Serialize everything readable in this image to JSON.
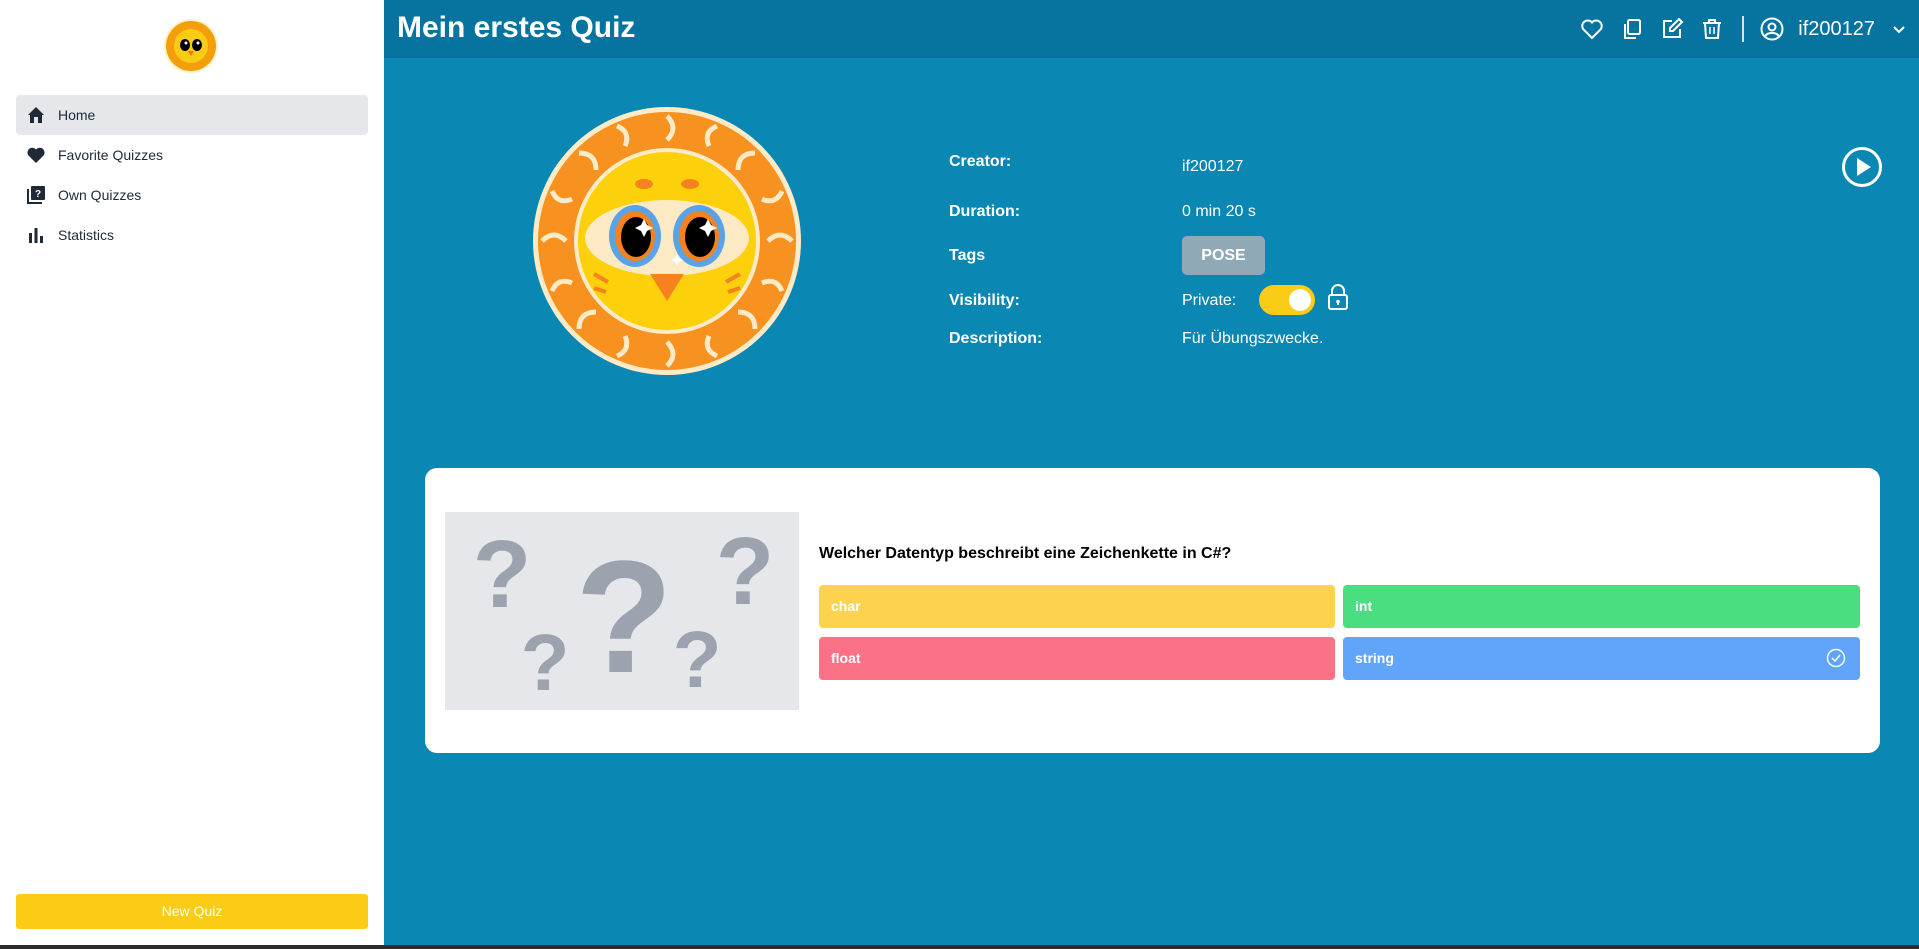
{
  "sidebar": {
    "items": [
      {
        "label": "Home",
        "icon": "home-icon",
        "active": true
      },
      {
        "label": "Favorite Quizzes",
        "icon": "heart-icon",
        "active": false
      },
      {
        "label": "Own Quizzes",
        "icon": "quiz-library-icon",
        "active": false
      },
      {
        "label": "Statistics",
        "icon": "bar-chart-icon",
        "active": false
      }
    ],
    "new_quiz_label": "New Quiz"
  },
  "header": {
    "title": "Mein erstes Quiz",
    "actions": [
      "heart-outline-icon",
      "copy-icon",
      "edit-icon",
      "trash-icon"
    ],
    "username": "if200127"
  },
  "quiz_info": {
    "creator_label": "Creator:",
    "creator": "if200127",
    "duration_label": "Duration:",
    "duration": "0 min 20 s",
    "tags_label": "Tags",
    "tag": "POSE",
    "visibility_label": "Visibility:",
    "visibility_value": "Private:",
    "private": true,
    "description_label": "Description:",
    "description": "Für Übungszwecke."
  },
  "question": {
    "text": "Welcher Datentyp beschreibt eine Zeichenkette in C#?",
    "answers": [
      {
        "label": "char",
        "color": "#fdd24e",
        "correct": false
      },
      {
        "label": "int",
        "color": "#4ade80",
        "correct": false
      },
      {
        "label": "float",
        "color": "#fb7185",
        "correct": false
      },
      {
        "label": "string",
        "color": "#60a5fa",
        "correct": true
      }
    ]
  },
  "colors": {
    "main_bg": "#0a87b2",
    "topbar_bg": "#0774a0",
    "accent": "#facc15"
  }
}
